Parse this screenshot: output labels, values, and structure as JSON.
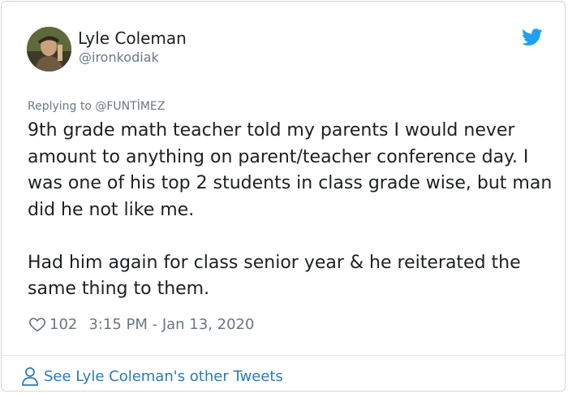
{
  "tweet": {
    "author_name": "Lyle Coleman",
    "author_handle": "@ironkodiak",
    "reply_context": "Replying to @FUNTİMEZ",
    "paragraphs": [
      "9th grade math teacher told my parents I would never amount to anything on parent/teacher conference day. I was one of his top 2 students in class grade wise, but man did he not like me.",
      "Had him again for class senior year & he reiterated the same thing to them."
    ],
    "like_count": "102",
    "timestamp": "3:15 PM - Jan 13, 2020",
    "footer_link": "See Lyle Coleman's other Tweets"
  },
  "icons": {
    "avatar": "avatar",
    "brand": "twitter-bird-icon",
    "like": "heart-icon",
    "profile": "person-icon"
  },
  "colors": {
    "brand": "#1da1f2",
    "link": "#2b7bb9",
    "muted": "#697882",
    "text": "#1c2022"
  }
}
